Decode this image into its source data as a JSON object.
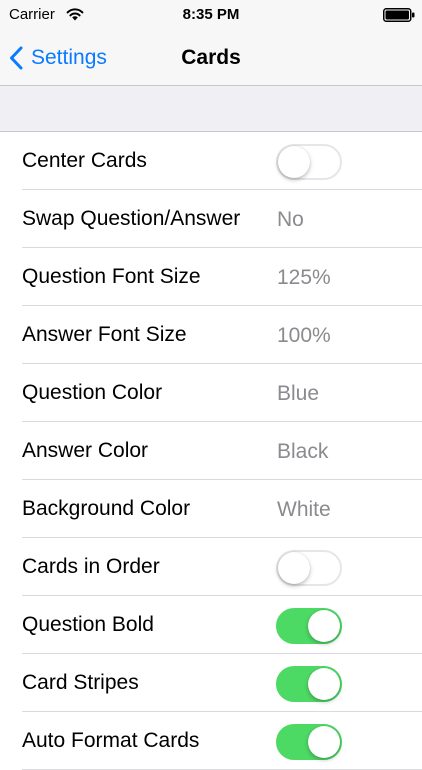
{
  "status_bar": {
    "carrier": "Carrier",
    "wifi_icon": "wifi-icon",
    "time": "8:35 PM",
    "battery_icon": "battery-icon"
  },
  "nav": {
    "back_icon": "chevron-left-icon",
    "back_label": "Settings",
    "title": "Cards"
  },
  "colors": {
    "accent": "#0a7aff",
    "toggle_on": "#4cd964",
    "value_text": "#8a8a8f",
    "grouped_background": "#efeff4"
  },
  "settings": [
    {
      "label": "Center Cards",
      "type": "toggle",
      "on": false
    },
    {
      "label": "Swap Question/Answer",
      "type": "value",
      "value": "No"
    },
    {
      "label": "Question Font Size",
      "type": "value",
      "value": "125%"
    },
    {
      "label": "Answer Font Size",
      "type": "value",
      "value": "100%"
    },
    {
      "label": "Question Color",
      "type": "value",
      "value": "Blue"
    },
    {
      "label": "Answer Color",
      "type": "value",
      "value": "Black"
    },
    {
      "label": "Background Color",
      "type": "value",
      "value": "White"
    },
    {
      "label": "Cards in Order",
      "type": "toggle",
      "on": false
    },
    {
      "label": "Question Bold",
      "type": "toggle",
      "on": true
    },
    {
      "label": "Card Stripes",
      "type": "toggle",
      "on": true
    },
    {
      "label": "Auto Format Cards",
      "type": "toggle",
      "on": true
    }
  ]
}
